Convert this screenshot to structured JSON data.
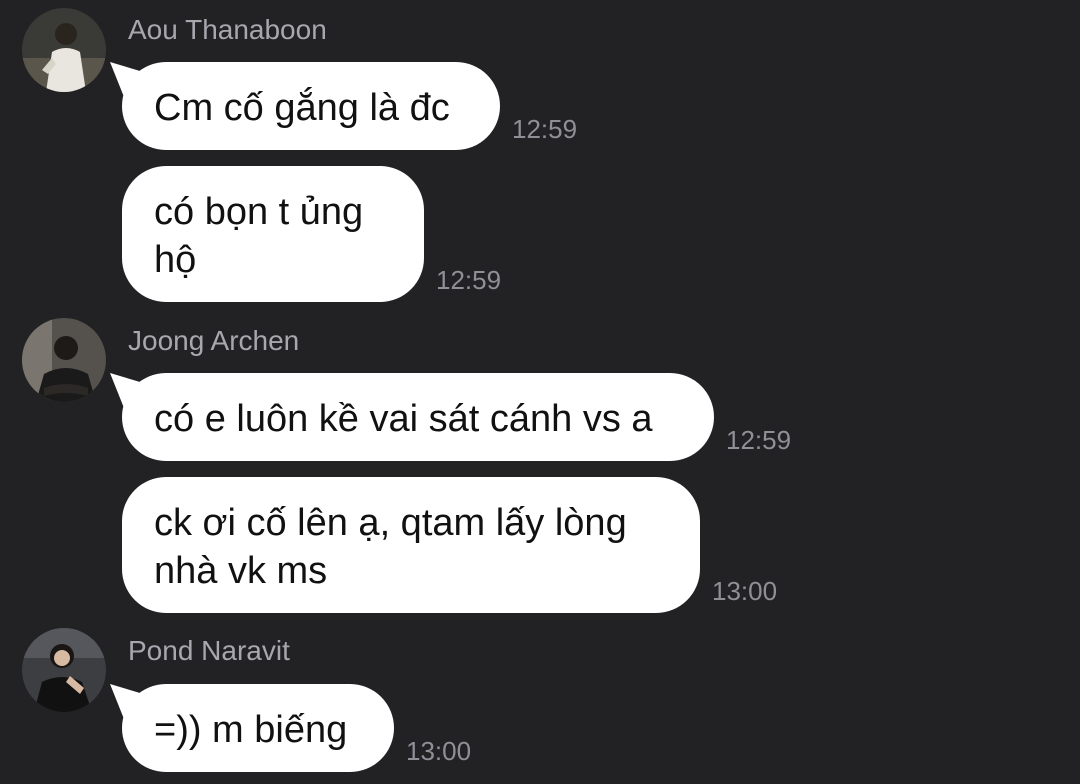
{
  "groups": [
    {
      "sender": "Aou Thanaboon",
      "messages": [
        {
          "text": "Cm cố gắng là đc",
          "time": "12:59"
        },
        {
          "text": "có bọn t ủng hộ",
          "time": "12:59"
        }
      ]
    },
    {
      "sender": "Joong Archen",
      "messages": [
        {
          "text": "có e luôn kề vai sát cánh vs a",
          "time": "12:59"
        },
        {
          "text": "ck ơi cố lên ạ, qtam lấy lòng nhà vk ms",
          "time": "13:00"
        }
      ]
    },
    {
      "sender": "Pond Naravit",
      "messages": [
        {
          "text": "=)) m biếng",
          "time": "13:00"
        }
      ]
    }
  ],
  "colors": {
    "background": "#222224",
    "bubble": "#ffffff",
    "sender_text": "#a7a7ad",
    "time_text": "#8f8f95"
  }
}
